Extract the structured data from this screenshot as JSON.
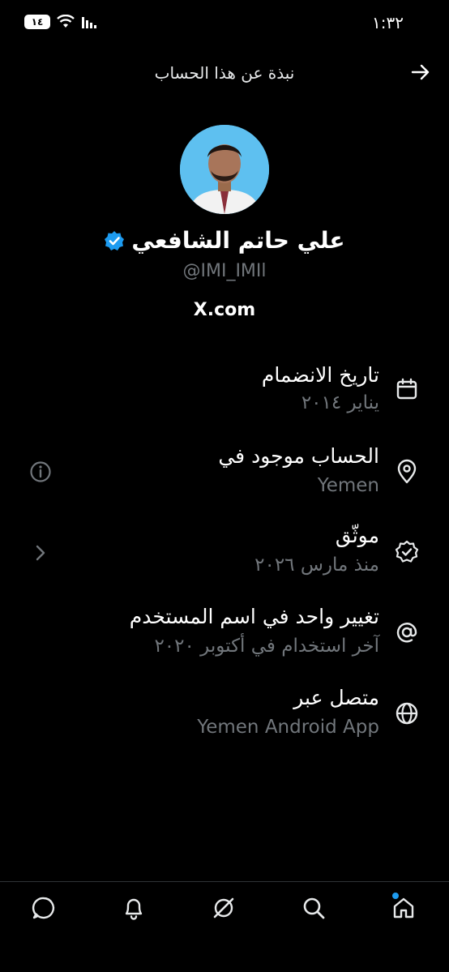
{
  "status_bar": {
    "time": "١:٣٢",
    "battery": "١٤"
  },
  "header": {
    "title": "نبذة عن هذا الحساب"
  },
  "profile": {
    "name": "علي حاتم الشافعي",
    "handle": "@IMI_IMIl",
    "site": "X.com",
    "verified": true
  },
  "rows": [
    {
      "title": "تاريخ الانضمام",
      "subtitle": "يناير ٢٠١٤",
      "icon": "calendar-icon"
    },
    {
      "title": "الحساب موجود في",
      "subtitle": "Yemen",
      "icon": "location-pin-icon"
    },
    {
      "title": "موثّق",
      "subtitle": "منذ مارس ٢٠٢٦",
      "icon": "verified-badge-icon"
    },
    {
      "title": "تغيير واحد في اسم المستخدم",
      "subtitle": "آخر استخدام في أكتوبر ٢٠٢٠",
      "icon": "at-sign-icon"
    },
    {
      "title": "متصل عبر",
      "subtitle": "Yemen Android App",
      "icon": "globe-icon"
    }
  ],
  "colors": {
    "background": "#000000",
    "primary_text": "#e7e9ea",
    "secondary_text": "#71767b",
    "accent": "#1d9bf0"
  }
}
